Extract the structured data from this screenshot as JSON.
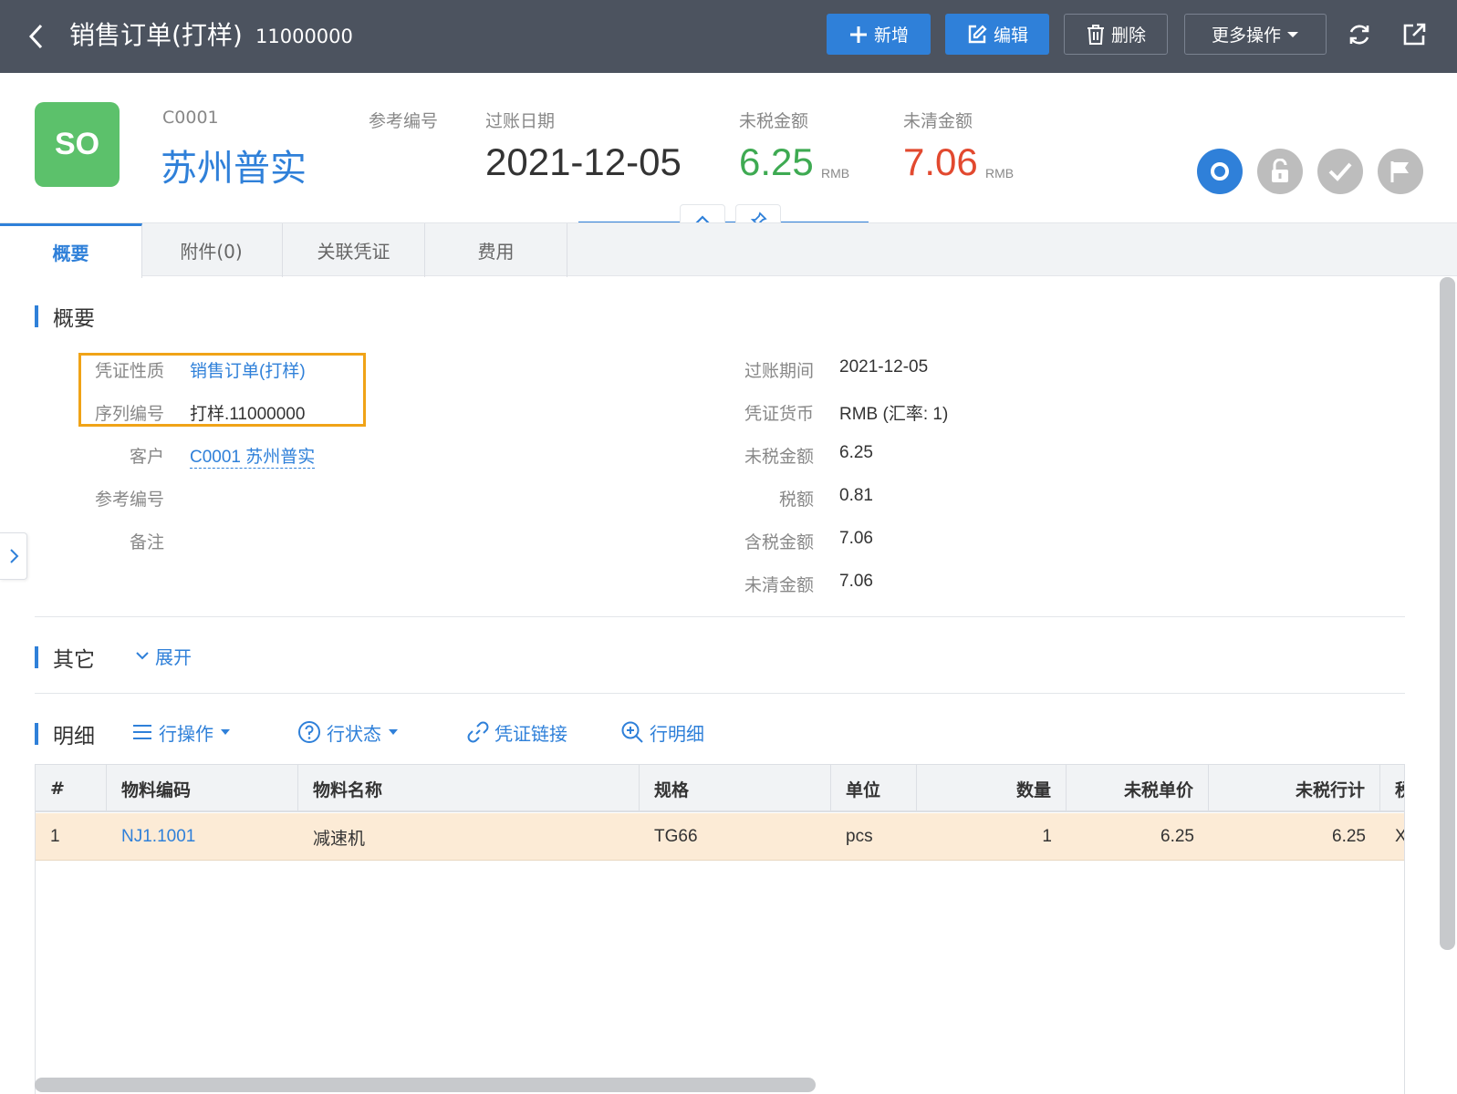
{
  "topbar": {
    "title": "销售订单(打样)",
    "doc_no": "11000000",
    "buttons": {
      "add": "新增",
      "edit": "编辑",
      "delete": "删除",
      "more": "更多操作"
    }
  },
  "header": {
    "logo": "SO",
    "customer_code": "C0001",
    "customer_name": "苏州普实",
    "ref_no_label": "参考编号",
    "post_date_label": "过账日期",
    "post_date": "2021-12-05",
    "pretax_label": "未税金额",
    "pretax_amount": "6.25",
    "pretax_unit": "RMB",
    "open_label": "未清金额",
    "open_amount": "7.06",
    "open_unit": "RMB"
  },
  "tabs": [
    {
      "label": "概要",
      "active": true
    },
    {
      "label": "附件(0)",
      "active": false
    },
    {
      "label": "关联凭证",
      "active": false
    },
    {
      "label": "费用",
      "active": false
    }
  ],
  "summary": {
    "title": "概要",
    "left": [
      {
        "label": "凭证性质",
        "value": "销售订单(打样)"
      },
      {
        "label": "序列编号",
        "value": "打样.11000000"
      },
      {
        "label": "客户",
        "value": "C0001 苏州普实"
      },
      {
        "label": "参考编号",
        "value": ""
      },
      {
        "label": "备注",
        "value": ""
      }
    ],
    "right": [
      {
        "label": "过账期间",
        "value": "2021-12-05"
      },
      {
        "label": "凭证货币",
        "value": "RMB (汇率: 1)"
      },
      {
        "label": "未税金额",
        "value": "6.25"
      },
      {
        "label": "税额",
        "value": "0.81"
      },
      {
        "label": "含税金额",
        "value": "7.06"
      },
      {
        "label": "未清金额",
        "value": "7.06"
      }
    ]
  },
  "other": {
    "title": "其它",
    "expand": "展开"
  },
  "detail": {
    "title": "明细",
    "toolbar": {
      "row_ops": "行操作",
      "row_status": "行状态",
      "voucher_link": "凭证链接",
      "row_detail": "行明细"
    },
    "columns": [
      "#",
      "物料编码",
      "物料名称",
      "规格",
      "单位",
      "数量",
      "未税单价",
      "未税行计",
      "税"
    ],
    "rows": [
      [
        "1",
        "NJ1.1001",
        "减速机",
        "TG66",
        "pcs",
        "1",
        "6.25",
        "6.25",
        "X"
      ]
    ]
  },
  "colors": {
    "topbar": "#4c535f",
    "primary": "#2f80d9",
    "logo": "#5cc16b",
    "pretax": "#3eaa52",
    "open": "#e2492f",
    "highlight": "#f0a317",
    "row_selected": "#fcebd6"
  }
}
